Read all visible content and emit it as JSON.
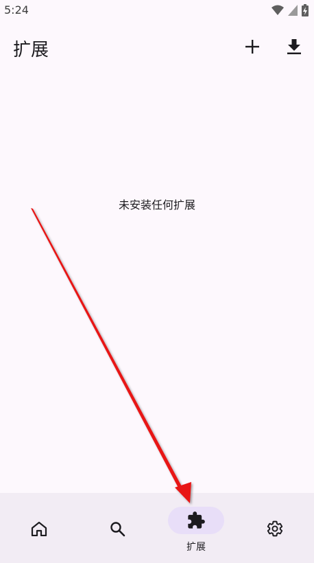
{
  "status_bar": {
    "time": "5:24"
  },
  "app_bar": {
    "title": "扩展"
  },
  "main": {
    "empty_message": "未安装任何扩展"
  },
  "bottom_nav": {
    "items": [
      {
        "icon": "home-icon",
        "label": ""
      },
      {
        "icon": "search-icon",
        "label": ""
      },
      {
        "icon": "extension-icon",
        "label": "扩展",
        "selected": true
      },
      {
        "icon": "gear-icon",
        "label": ""
      }
    ]
  },
  "colors": {
    "background": "#fdf8fd",
    "nav_background": "#f2ecf4",
    "indicator": "#e8def8",
    "annotation_arrow": "#e81818"
  }
}
